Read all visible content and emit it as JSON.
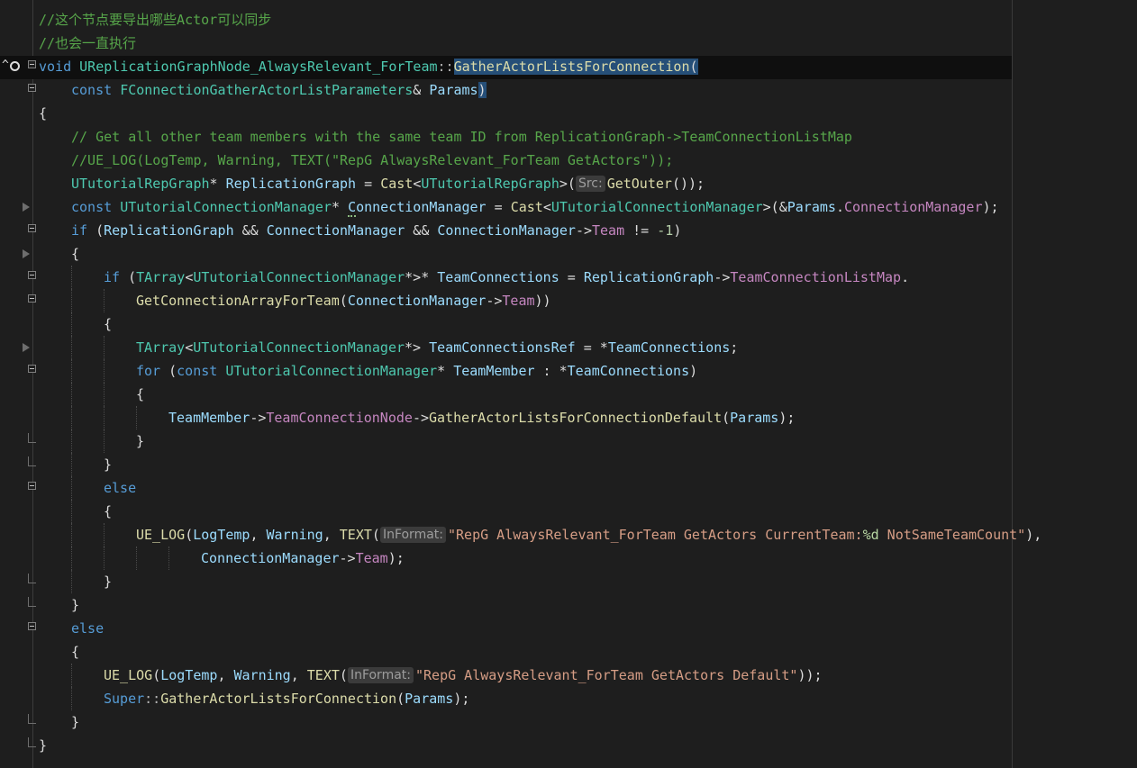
{
  "editor": {
    "lines": [
      {
        "segments": [
          {
            "cls": "c-comment",
            "text": "//这个节点要导出哪些Actor可以同步"
          }
        ]
      },
      {
        "segments": [
          {
            "cls": "c-comment",
            "text": "//也会一直执行"
          }
        ]
      },
      {
        "segments": [
          {
            "cls": "c-kw",
            "text": "void"
          },
          {
            "cls": "",
            "text": " "
          },
          {
            "cls": "c-type",
            "text": "UReplicationGraphNode_AlwaysRelevant_ForTeam"
          },
          {
            "cls": "c-op",
            "text": "::"
          },
          {
            "cls": "c-func hl",
            "text": "GatherActorListsForConnection"
          },
          {
            "cls": "hl",
            "text": "("
          }
        ]
      },
      {
        "segments": [
          {
            "cls": "c-kw",
            "text": "const"
          },
          {
            "cls": "",
            "text": " "
          },
          {
            "cls": "c-type",
            "text": "FConnectionGatherActorListParameters"
          },
          {
            "cls": "",
            "text": "& "
          },
          {
            "cls": "c-var",
            "text": "Params"
          },
          {
            "cls": "hl",
            "text": ")"
          }
        ]
      },
      {
        "segments": [
          {
            "cls": "",
            "text": "{"
          }
        ]
      },
      {
        "segments": [
          {
            "cls": "c-comment",
            "text": "// Get all other team members with the same team ID from ReplicationGraph->TeamConnectionListMap"
          }
        ]
      },
      {
        "segments": [
          {
            "cls": "c-comment",
            "text": "//UE_LOG(LogTemp, Warning, TEXT(\"RepG AlwaysRelevant_ForTeam GetActors\"));"
          }
        ]
      },
      {
        "segments": [
          {
            "cls": "c-type",
            "text": "UTutorialRepGraph"
          },
          {
            "cls": "",
            "text": "* "
          },
          {
            "cls": "c-var",
            "text": "ReplicationGraph"
          },
          {
            "cls": "",
            "text": " = "
          },
          {
            "cls": "c-func",
            "text": "Cast"
          },
          {
            "cls": "",
            "text": "<"
          },
          {
            "cls": "c-type",
            "text": "UTutorialRepGraph"
          },
          {
            "cls": "",
            "text": ">("
          },
          {
            "cls": "hint",
            "text": "Src:"
          },
          {
            "cls": "c-func",
            "text": "GetOuter"
          },
          {
            "cls": "",
            "text": "());"
          }
        ]
      },
      {
        "segments": [
          {
            "cls": "c-kw",
            "text": "const"
          },
          {
            "cls": "",
            "text": " "
          },
          {
            "cls": "c-type",
            "text": "UTutorialConnectionManager"
          },
          {
            "cls": "",
            "text": "* "
          },
          {
            "cls": "c-var hl-sq",
            "text": "C"
          },
          {
            "cls": "c-var",
            "text": "onnectionManager"
          },
          {
            "cls": "",
            "text": " = "
          },
          {
            "cls": "c-func",
            "text": "Cast"
          },
          {
            "cls": "",
            "text": "<"
          },
          {
            "cls": "c-type",
            "text": "UTutorialConnectionManager"
          },
          {
            "cls": "",
            "text": ">(&"
          },
          {
            "cls": "c-var",
            "text": "Params"
          },
          {
            "cls": "",
            "text": "."
          },
          {
            "cls": "c-field",
            "text": "ConnectionManager"
          },
          {
            "cls": "",
            "text": ");"
          }
        ]
      },
      {
        "segments": [
          {
            "cls": "c-kw",
            "text": "if"
          },
          {
            "cls": "",
            "text": " ("
          },
          {
            "cls": "c-var",
            "text": "ReplicationGraph"
          },
          {
            "cls": "",
            "text": " && "
          },
          {
            "cls": "c-var",
            "text": "ConnectionManager"
          },
          {
            "cls": "",
            "text": " && "
          },
          {
            "cls": "c-var",
            "text": "ConnectionManager"
          },
          {
            "cls": "",
            "text": "->"
          },
          {
            "cls": "c-field",
            "text": "Team"
          },
          {
            "cls": "",
            "text": " != "
          },
          {
            "cls": "c-num",
            "text": "-1"
          },
          {
            "cls": "",
            "text": ")"
          }
        ]
      },
      {
        "segments": [
          {
            "cls": "",
            "text": "{"
          }
        ]
      },
      {
        "segments": [
          {
            "cls": "c-kw",
            "text": "if"
          },
          {
            "cls": "",
            "text": " ("
          },
          {
            "cls": "c-type",
            "text": "TArray"
          },
          {
            "cls": "",
            "text": "<"
          },
          {
            "cls": "c-type",
            "text": "UTutorialConnectionManager"
          },
          {
            "cls": "",
            "text": "*>* "
          },
          {
            "cls": "c-var",
            "text": "TeamConnections"
          },
          {
            "cls": "",
            "text": " = "
          },
          {
            "cls": "c-var",
            "text": "ReplicationGraph"
          },
          {
            "cls": "",
            "text": "->"
          },
          {
            "cls": "c-field",
            "text": "TeamConnectionListMap"
          },
          {
            "cls": "",
            "text": "."
          }
        ]
      },
      {
        "segments": [
          {
            "cls": "c-func",
            "text": "GetConnectionArrayForTeam"
          },
          {
            "cls": "",
            "text": "("
          },
          {
            "cls": "c-var",
            "text": "ConnectionManager"
          },
          {
            "cls": "",
            "text": "->"
          },
          {
            "cls": "c-field",
            "text": "Team"
          },
          {
            "cls": "",
            "text": "))"
          }
        ]
      },
      {
        "segments": [
          {
            "cls": "",
            "text": "{"
          }
        ]
      },
      {
        "segments": [
          {
            "cls": "c-type",
            "text": "TArray"
          },
          {
            "cls": "",
            "text": "<"
          },
          {
            "cls": "c-type",
            "text": "UTutorialConnectionManager"
          },
          {
            "cls": "",
            "text": "*> "
          },
          {
            "cls": "c-var",
            "text": "TeamConnectionsRef"
          },
          {
            "cls": "",
            "text": " = *"
          },
          {
            "cls": "c-var",
            "text": "TeamConnections"
          },
          {
            "cls": "",
            "text": ";"
          }
        ]
      },
      {
        "segments": [
          {
            "cls": "c-kw",
            "text": "for"
          },
          {
            "cls": "",
            "text": " ("
          },
          {
            "cls": "c-kw",
            "text": "const"
          },
          {
            "cls": "",
            "text": " "
          },
          {
            "cls": "c-type",
            "text": "UTutorialConnectionManager"
          },
          {
            "cls": "",
            "text": "* "
          },
          {
            "cls": "c-var",
            "text": "TeamMember"
          },
          {
            "cls": "",
            "text": " : *"
          },
          {
            "cls": "c-var",
            "text": "TeamConnections"
          },
          {
            "cls": "",
            "text": ")"
          }
        ]
      },
      {
        "segments": [
          {
            "cls": "",
            "text": "{"
          }
        ]
      },
      {
        "segments": [
          {
            "cls": "c-var",
            "text": "TeamMember"
          },
          {
            "cls": "",
            "text": "->"
          },
          {
            "cls": "c-field",
            "text": "TeamConnectionNode"
          },
          {
            "cls": "",
            "text": "->"
          },
          {
            "cls": "c-func",
            "text": "GatherActorListsForConnectionDefault"
          },
          {
            "cls": "",
            "text": "("
          },
          {
            "cls": "c-var",
            "text": "Params"
          },
          {
            "cls": "",
            "text": ");"
          }
        ]
      },
      {
        "segments": [
          {
            "cls": "",
            "text": "}"
          }
        ]
      },
      {
        "segments": [
          {
            "cls": "",
            "text": "}"
          }
        ]
      },
      {
        "segments": [
          {
            "cls": "c-kw",
            "text": "else"
          }
        ]
      },
      {
        "segments": [
          {
            "cls": "",
            "text": "{"
          }
        ]
      },
      {
        "segments": [
          {
            "cls": "c-func",
            "text": "UE_LOG"
          },
          {
            "cls": "",
            "text": "("
          },
          {
            "cls": "c-var",
            "text": "LogTemp"
          },
          {
            "cls": "",
            "text": ", "
          },
          {
            "cls": "c-var",
            "text": "Warning"
          },
          {
            "cls": "",
            "text": ", "
          },
          {
            "cls": "c-func",
            "text": "TEXT"
          },
          {
            "cls": "",
            "text": "("
          },
          {
            "cls": "hint",
            "text": "InFormat:"
          },
          {
            "cls": "c-str",
            "text": "\"RepG AlwaysRelevant_ForTeam GetActors CurrentTeam:"
          },
          {
            "cls": "c-fmt",
            "text": "%d"
          },
          {
            "cls": "c-str",
            "text": " NotSameTeamCount\""
          },
          {
            "cls": "",
            "text": "),"
          }
        ]
      },
      {
        "segments": [
          {
            "cls": "c-var",
            "text": "ConnectionManager"
          },
          {
            "cls": "",
            "text": "->"
          },
          {
            "cls": "c-field",
            "text": "Team"
          },
          {
            "cls": "",
            "text": ");"
          }
        ]
      },
      {
        "segments": [
          {
            "cls": "",
            "text": "}"
          }
        ]
      },
      {
        "segments": [
          {
            "cls": "",
            "text": "}"
          }
        ]
      },
      {
        "segments": [
          {
            "cls": "c-kw",
            "text": "else"
          }
        ]
      },
      {
        "segments": [
          {
            "cls": "",
            "text": "{"
          }
        ]
      },
      {
        "segments": [
          {
            "cls": "c-func",
            "text": "UE_LOG"
          },
          {
            "cls": "",
            "text": "("
          },
          {
            "cls": "c-var",
            "text": "LogTemp"
          },
          {
            "cls": "",
            "text": ", "
          },
          {
            "cls": "c-var",
            "text": "Warning"
          },
          {
            "cls": "",
            "text": ", "
          },
          {
            "cls": "c-func",
            "text": "TEXT"
          },
          {
            "cls": "",
            "text": "("
          },
          {
            "cls": "hint",
            "text": "InFormat:"
          },
          {
            "cls": "c-str",
            "text": "\"RepG AlwaysRelevant_ForTeam GetActors Default\""
          },
          {
            "cls": "",
            "text": "));"
          }
        ]
      },
      {
        "segments": [
          {
            "cls": "c-kw",
            "text": "Super"
          },
          {
            "cls": "c-op",
            "text": "::"
          },
          {
            "cls": "c-func",
            "text": "GatherActorListsForConnection"
          },
          {
            "cls": "",
            "text": "("
          },
          {
            "cls": "c-var",
            "text": "Params"
          },
          {
            "cls": "",
            "text": ");"
          }
        ]
      },
      {
        "segments": [
          {
            "cls": "",
            "text": "}"
          }
        ]
      },
      {
        "segments": [
          {
            "cls": "",
            "text": "}"
          }
        ]
      }
    ]
  }
}
